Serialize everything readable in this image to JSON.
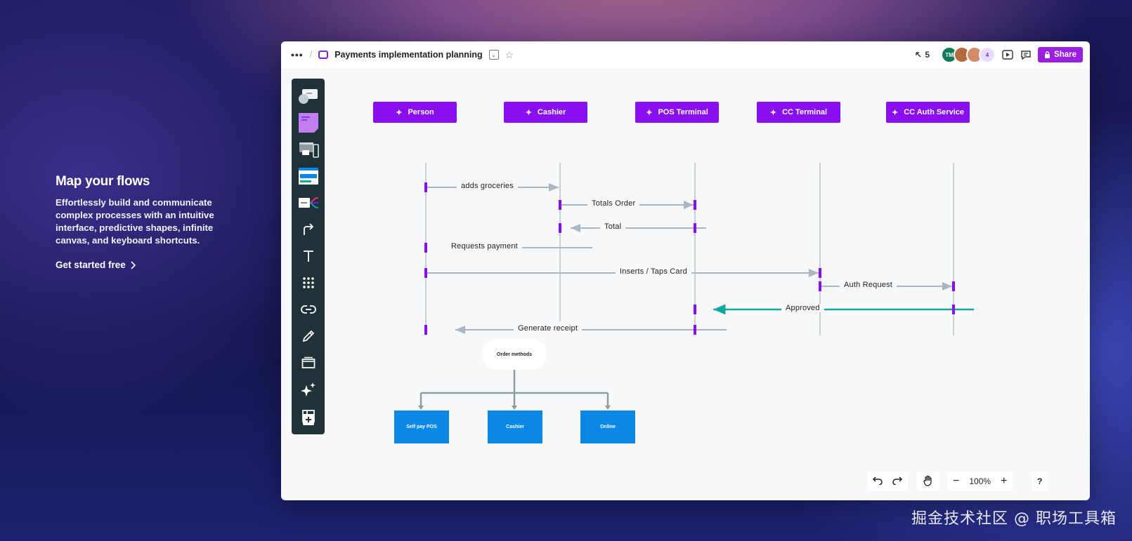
{
  "hero": {
    "title": "Map your flows",
    "description": "Effortlessly build and communicate complex processes with an intuitive interface, predictive shapes, infinite canvas, and keyboard shortcuts.",
    "cta": "Get started free",
    "cta_icon": "chevron-right-icon"
  },
  "topbar": {
    "menu_icon": "more-dots-icon",
    "board_title": "Payments implementation planning",
    "cursor_count": "5",
    "avatars": [
      {
        "initials": "TM",
        "color": "#0f7a5a"
      },
      {
        "initials": "",
        "color": "#b36b3d"
      },
      {
        "initials": "",
        "color": "#d48b6a"
      }
    ],
    "extra_count": "4",
    "share_label": "Share",
    "accent": "#9a1fe0"
  },
  "toolbar": {
    "tools": [
      "templates-icon",
      "sticky-note-icon",
      "wireframe-icon",
      "card-icon",
      "mindmap-icon",
      "connector-icon",
      "text-icon",
      "shapes-grid-icon",
      "link-icon",
      "pen-icon",
      "frame-icon",
      "ai-sparkle-icon",
      "layout-icon",
      "add-more-icon"
    ]
  },
  "diagram": {
    "lifelines": [
      "Person",
      "Cashier",
      "POS Terminal",
      "CC Terminal",
      "CC Auth Service"
    ],
    "messages": [
      "adds groceries",
      "Totals Order",
      "Total",
      "Requests payment",
      "Inserts / Taps Card",
      "Auth Request",
      "Approved",
      "Generate receipt"
    ],
    "approved_color": "#12a89a",
    "tree": {
      "root": "Order methods",
      "children": [
        "Self pay POS",
        "Cashier",
        "Online"
      ]
    }
  },
  "bottom": {
    "zoom": "100%",
    "help": "?"
  },
  "watermark": "掘金技术社区 @ 职场工具箱"
}
